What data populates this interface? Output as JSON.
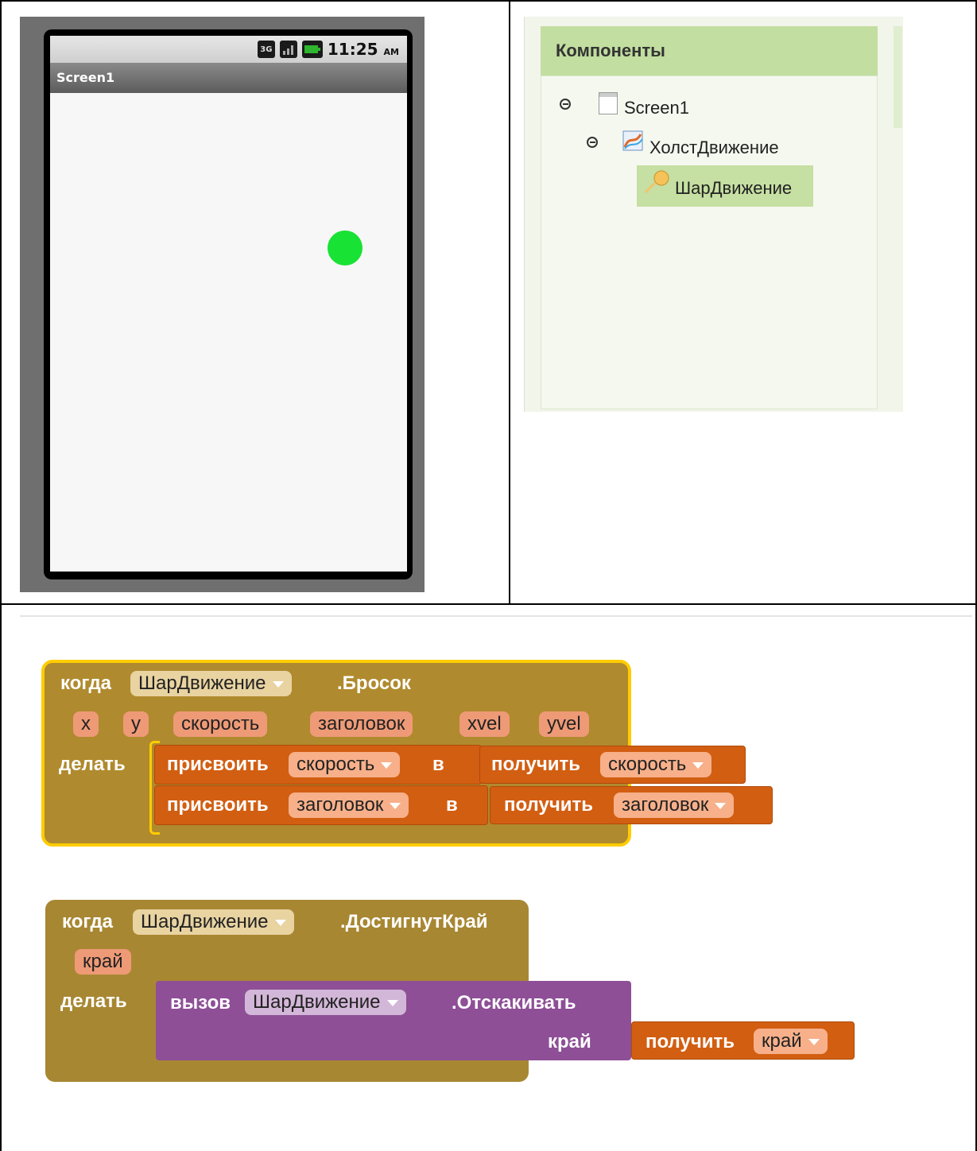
{
  "phone": {
    "status_time": "11:25",
    "status_ampm": "AM",
    "status_3g": "3G",
    "screen_title": "Screen1"
  },
  "components": {
    "header": "Компоненты",
    "tree": [
      {
        "label": "Screen1"
      },
      {
        "label": "ХолстДвижение"
      },
      {
        "label": "ШарДвижение"
      }
    ]
  },
  "block1": {
    "when": "когда",
    "component": "ШарДвижение",
    "event": ".Бросок",
    "params": [
      "x",
      "y",
      "скорость",
      "заголовок",
      "xvel",
      "yvel"
    ],
    "do": "делать",
    "stmts": [
      {
        "set": "присвоить",
        "var": "скорость",
        "to": "в",
        "get": "получить",
        "get_var": "скорость"
      },
      {
        "set": "присвоить",
        "var": "заголовок",
        "to": "в",
        "get": "получить",
        "get_var": "заголовок"
      }
    ]
  },
  "block2": {
    "when": "когда",
    "component": "ШарДвижение",
    "event": ".ДостигнутКрай",
    "params": [
      "край"
    ],
    "do": "делать",
    "call": "вызов",
    "call_component": "ШарДвижение",
    "method": ".Отскакивать",
    "arg_label": "край",
    "get": "получить",
    "get_var": "край"
  },
  "colors": {
    "event_block": "#b08a2e",
    "event_highlight": "#ffcc00",
    "variable_block": "#d25e12",
    "call_block": "#8e4f97",
    "ball": "#18e234"
  }
}
